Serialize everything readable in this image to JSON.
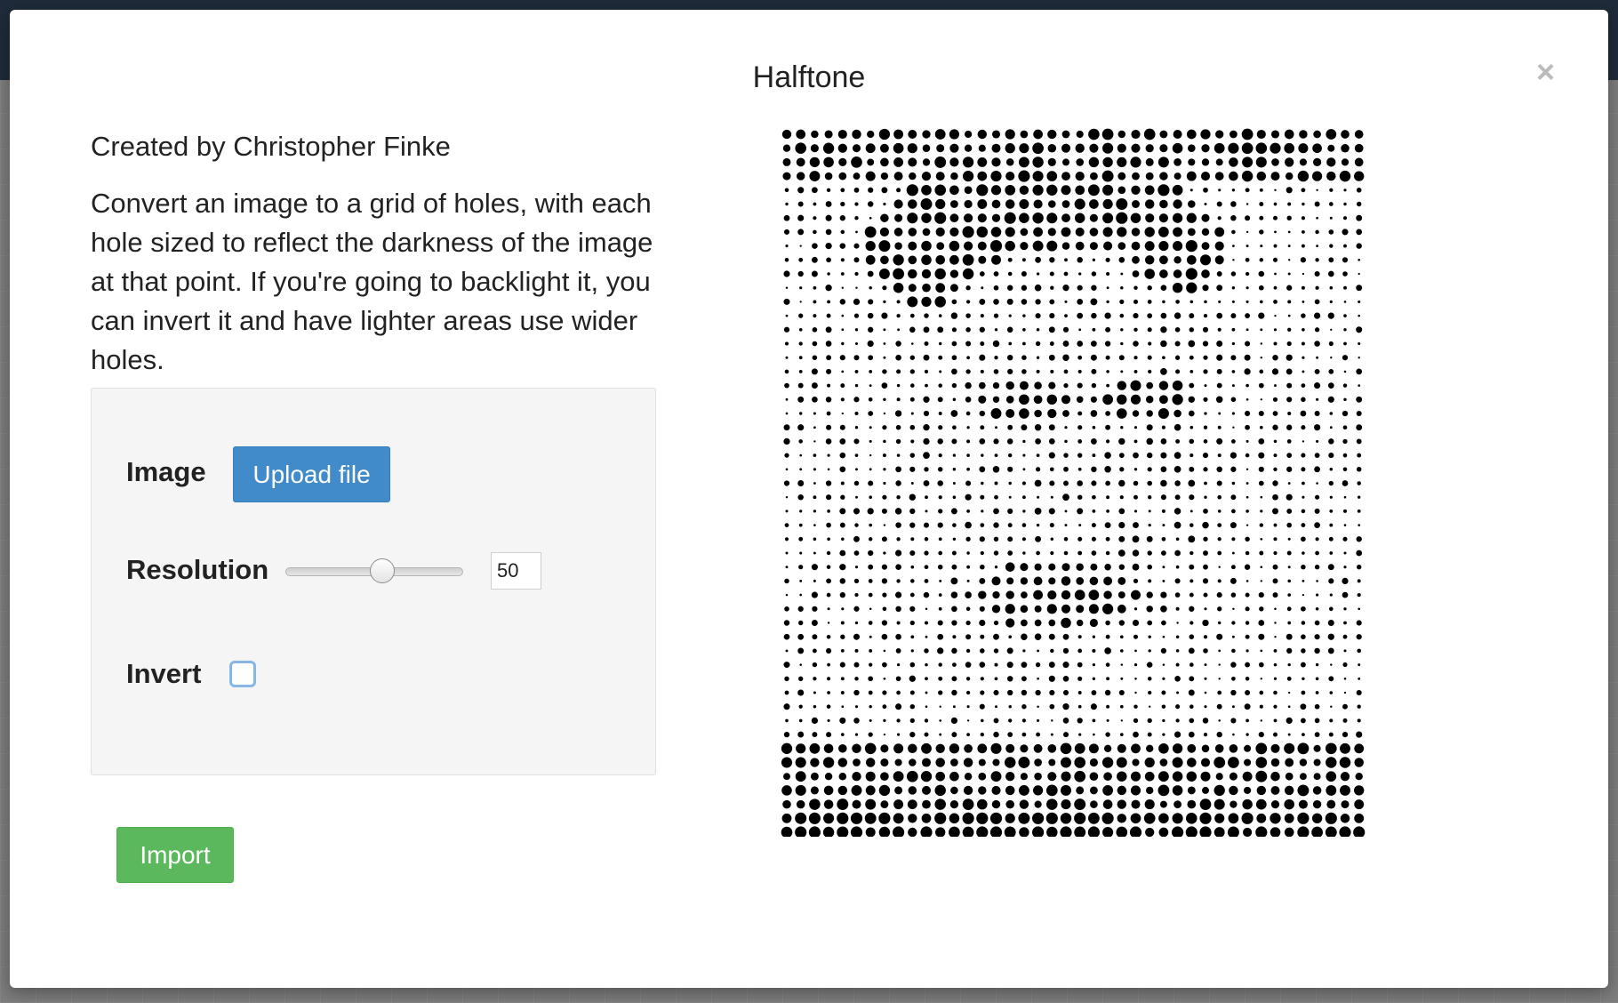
{
  "modal": {
    "title": "Halftone",
    "close_glyph": "×",
    "credit": "Created by Christopher Finke",
    "description": "Convert an image to a grid of holes, with each hole sized to reflect the darkness of the image at that point. If you're going to backlight it, you can invert it and have lighter areas use wider holes."
  },
  "controls": {
    "image_label": "Image",
    "upload_label": "Upload file",
    "resolution_label": "Resolution",
    "resolution_value": "50",
    "invert_label": "Invert",
    "invert_checked": false
  },
  "actions": {
    "import_label": "Import"
  },
  "preview": {
    "description": "halftone dot grid of a portrait photo",
    "dot_color": "#000000"
  },
  "colors": {
    "upload_button": "#428bca",
    "import_button": "#5cb85c",
    "panel_background": "#f5f5f5"
  }
}
